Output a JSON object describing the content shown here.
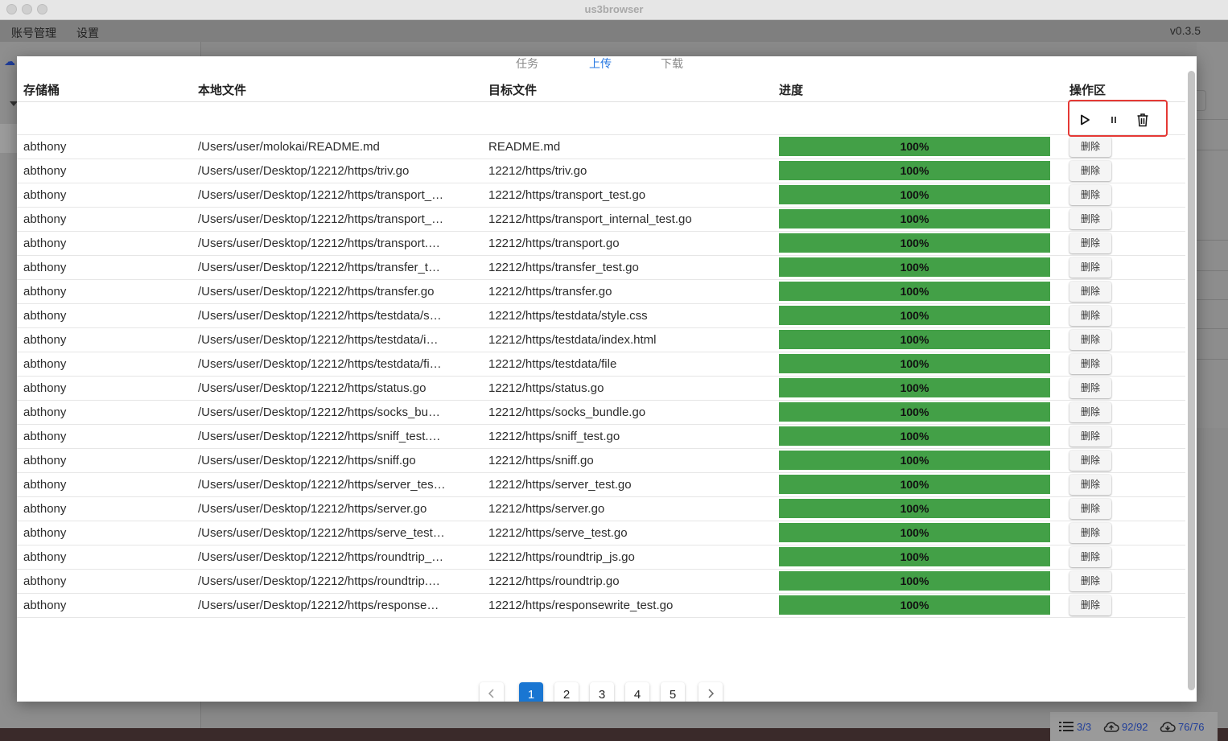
{
  "window": {
    "title": "us3browser",
    "version": "v0.3.5"
  },
  "menu": [
    "账号管理",
    "设置"
  ],
  "tabs": [
    {
      "label": "任务",
      "active": false
    },
    {
      "label": "上传",
      "active": true
    },
    {
      "label": "下载",
      "active": false
    }
  ],
  "columns": [
    "存储桶",
    "本地文件",
    "目标文件",
    "进度",
    "操作区"
  ],
  "rows": [
    {
      "bucket": "abthony",
      "local": "/Users/user/molokai/README.md",
      "target": "README.md",
      "progress": "100%",
      "action": "删除"
    },
    {
      "bucket": "abthony",
      "local": "/Users/user/Desktop/12212/https/triv.go",
      "target": "12212/https/triv.go",
      "progress": "100%",
      "action": "删除"
    },
    {
      "bucket": "abthony",
      "local": "/Users/user/Desktop/12212/https/transport_…",
      "target": "12212/https/transport_test.go",
      "progress": "100%",
      "action": "删除"
    },
    {
      "bucket": "abthony",
      "local": "/Users/user/Desktop/12212/https/transport_…",
      "target": "12212/https/transport_internal_test.go",
      "progress": "100%",
      "action": "删除"
    },
    {
      "bucket": "abthony",
      "local": "/Users/user/Desktop/12212/https/transport.…",
      "target": "12212/https/transport.go",
      "progress": "100%",
      "action": "删除"
    },
    {
      "bucket": "abthony",
      "local": "/Users/user/Desktop/12212/https/transfer_t…",
      "target": "12212/https/transfer_test.go",
      "progress": "100%",
      "action": "删除"
    },
    {
      "bucket": "abthony",
      "local": "/Users/user/Desktop/12212/https/transfer.go",
      "target": "12212/https/transfer.go",
      "progress": "100%",
      "action": "删除"
    },
    {
      "bucket": "abthony",
      "local": "/Users/user/Desktop/12212/https/testdata/s…",
      "target": "12212/https/testdata/style.css",
      "progress": "100%",
      "action": "删除"
    },
    {
      "bucket": "abthony",
      "local": "/Users/user/Desktop/12212/https/testdata/i…",
      "target": "12212/https/testdata/index.html",
      "progress": "100%",
      "action": "删除"
    },
    {
      "bucket": "abthony",
      "local": "/Users/user/Desktop/12212/https/testdata/fi…",
      "target": "12212/https/testdata/file",
      "progress": "100%",
      "action": "删除"
    },
    {
      "bucket": "abthony",
      "local": "/Users/user/Desktop/12212/https/status.go",
      "target": "12212/https/status.go",
      "progress": "100%",
      "action": "删除"
    },
    {
      "bucket": "abthony",
      "local": "/Users/user/Desktop/12212/https/socks_bu…",
      "target": "12212/https/socks_bundle.go",
      "progress": "100%",
      "action": "删除"
    },
    {
      "bucket": "abthony",
      "local": "/Users/user/Desktop/12212/https/sniff_test.…",
      "target": "12212/https/sniff_test.go",
      "progress": "100%",
      "action": "删除"
    },
    {
      "bucket": "abthony",
      "local": "/Users/user/Desktop/12212/https/sniff.go",
      "target": "12212/https/sniff.go",
      "progress": "100%",
      "action": "删除"
    },
    {
      "bucket": "abthony",
      "local": "/Users/user/Desktop/12212/https/server_tes…",
      "target": "12212/https/server_test.go",
      "progress": "100%",
      "action": "删除"
    },
    {
      "bucket": "abthony",
      "local": "/Users/user/Desktop/12212/https/server.go",
      "target": "12212/https/server.go",
      "progress": "100%",
      "action": "删除"
    },
    {
      "bucket": "abthony",
      "local": "/Users/user/Desktop/12212/https/serve_test…",
      "target": "12212/https/serve_test.go",
      "progress": "100%",
      "action": "删除"
    },
    {
      "bucket": "abthony",
      "local": "/Users/user/Desktop/12212/https/roundtrip_…",
      "target": "12212/https/roundtrip_js.go",
      "progress": "100%",
      "action": "删除"
    },
    {
      "bucket": "abthony",
      "local": "/Users/user/Desktop/12212/https/roundtrip.…",
      "target": "12212/https/roundtrip.go",
      "progress": "100%",
      "action": "删除"
    },
    {
      "bucket": "abthony",
      "local": "/Users/user/Desktop/12212/https/response…",
      "target": "12212/https/responsewrite_test.go",
      "progress": "100%",
      "action": "删除"
    }
  ],
  "toolbar_icons": [
    "play-icon",
    "pause-icon",
    "trash-icon"
  ],
  "pagination": {
    "pages": [
      "1",
      "2",
      "3",
      "4",
      "5"
    ],
    "current": "1"
  },
  "status": {
    "tasks": "3/3",
    "uploads": "92/92",
    "downloads": "76/76"
  },
  "colors": {
    "progress": "#43a047",
    "accent": "#1976d2",
    "highlight_box": "#e53935"
  }
}
